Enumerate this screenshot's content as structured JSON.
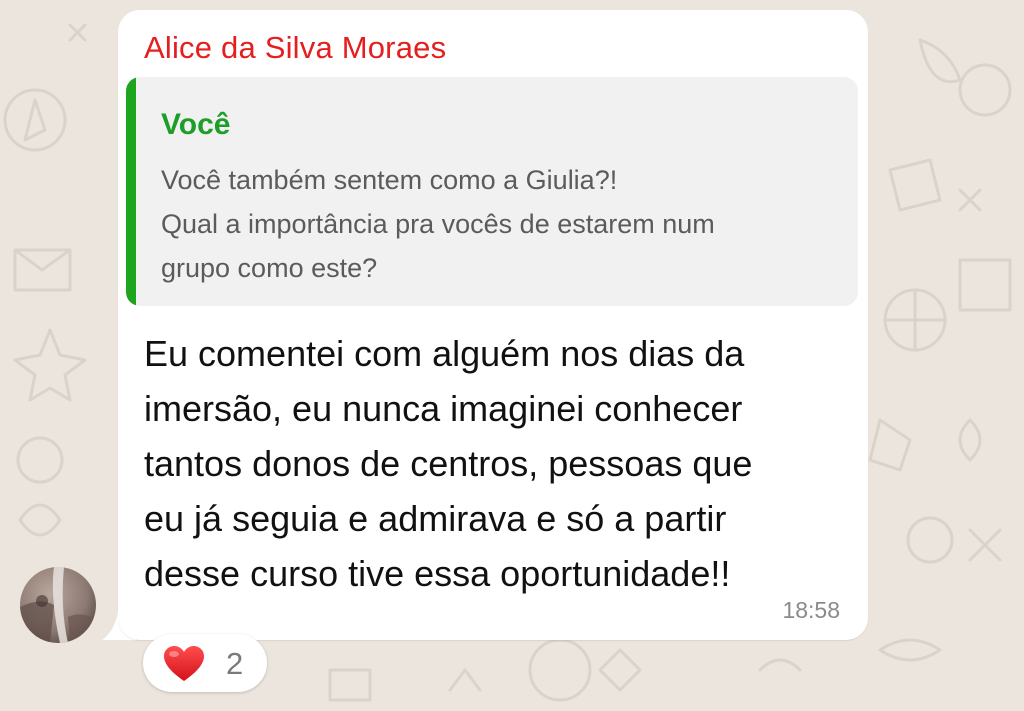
{
  "chat": {
    "message": {
      "sender": "Alice da Silva Moraes",
      "sender_color": "#e51e1e",
      "quoted": {
        "author": "Você",
        "author_color": "#1d9e28",
        "lines": [
          "Você também sentem como a Giulia?!",
          "Qual a importância pra vocês de estarem num",
          "grupo como este?"
        ]
      },
      "text_lines": [
        "Eu comentei com alguém nos dias da",
        "imersão, eu nunca imaginei conhecer",
        "tantos donos de centros, pessoas que",
        "eu já seguia e admirava e só a partir",
        "desse curso tive essa oportunidade!!"
      ],
      "time": "18:58",
      "reaction": {
        "emoji": "red-heart",
        "count": "2"
      }
    },
    "avatar": "sender-avatar"
  }
}
